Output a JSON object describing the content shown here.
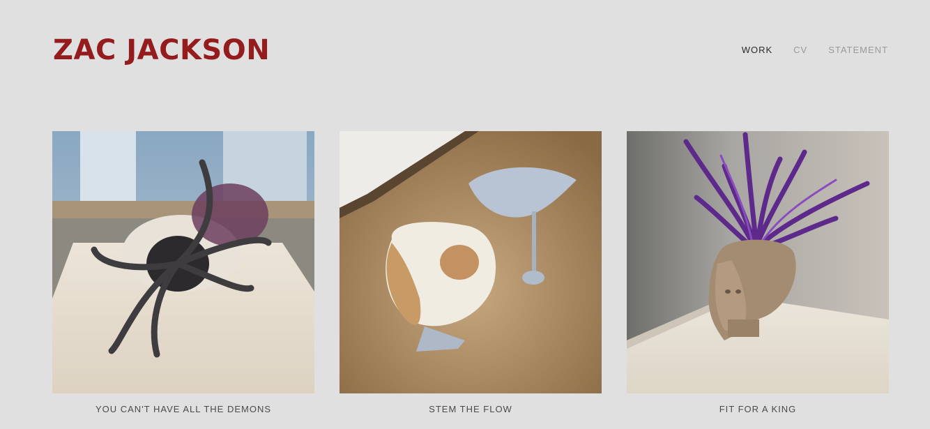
{
  "site": {
    "title": "ZAC JACKSON",
    "brand_color": "#941c1c"
  },
  "nav": {
    "items": [
      {
        "label": "WORK",
        "active": true
      },
      {
        "label": "CV",
        "active": false
      },
      {
        "label": "STATEMENT",
        "active": false
      }
    ]
  },
  "gallery": {
    "items": [
      {
        "title": "YOU CAN'T HAVE ALL THE DEMONS",
        "image": "sculpture-horns-skull"
      },
      {
        "title": "STEM THE FLOW",
        "image": "sculpture-cracked-face"
      },
      {
        "title": "FIT FOR A KING",
        "image": "sculpture-purple-crown-head"
      }
    ]
  }
}
